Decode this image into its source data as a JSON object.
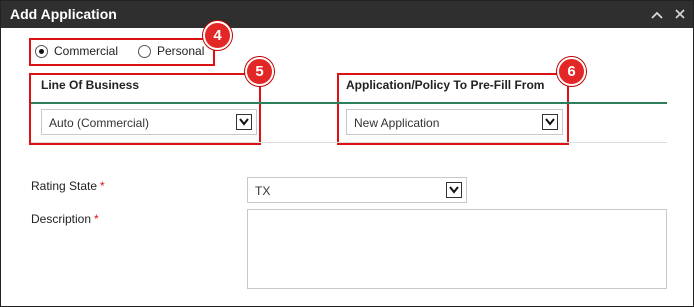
{
  "dialog": {
    "title": "Add Application",
    "collapse_glyph": "⌃",
    "close_glyph": "✕"
  },
  "customer_type": {
    "options": [
      {
        "label": "Commercial",
        "selected": true
      },
      {
        "label": "Personal",
        "selected": false
      }
    ]
  },
  "line_of_business": {
    "label": "Line Of Business",
    "value": "Auto (Commercial)"
  },
  "prefill": {
    "label": "Application/Policy To Pre-Fill From",
    "value": "New Application"
  },
  "rating_state": {
    "label": "Rating State",
    "required_mark": "*",
    "value": "TX"
  },
  "description": {
    "label": "Description",
    "required_mark": "*",
    "value": ""
  },
  "annotations": {
    "badge_4": "4",
    "badge_5": "5",
    "badge_6": "6",
    "highlight_color": "#d11111",
    "badge_color": "#e32626"
  },
  "colors": {
    "titlebar": "#2f2f2f",
    "section_rule": "#2e7d5b"
  }
}
